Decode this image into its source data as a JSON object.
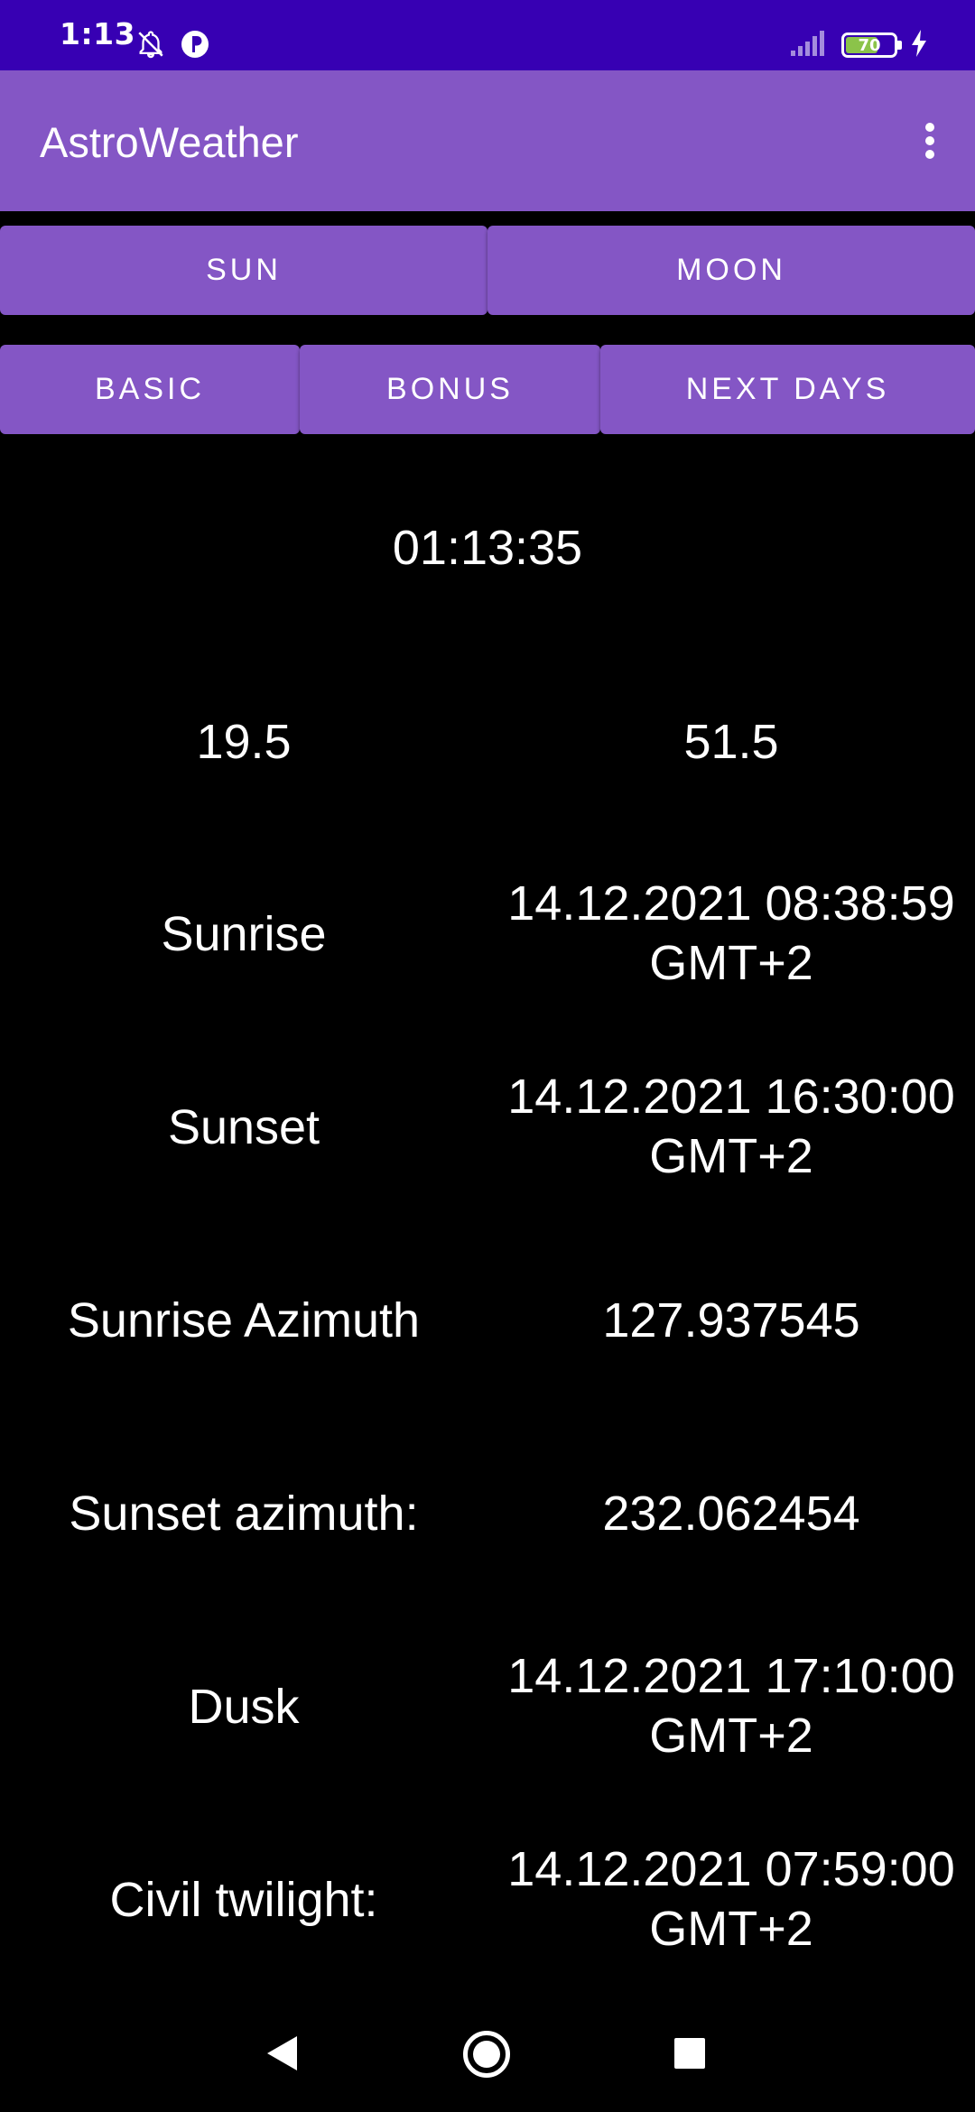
{
  "status_bar": {
    "time": "1:13",
    "battery_level": "70",
    "battery_fraction": 0.7,
    "icons": [
      "notifications-off-icon",
      "app-indicator-icon",
      "signal-icon",
      "battery-icon",
      "charging-bolt-icon"
    ]
  },
  "app_bar": {
    "title": "AstroWeather",
    "menu_icon": "more-vert-icon"
  },
  "tabs_row1": {
    "sun": "SUN",
    "moon": "MOON"
  },
  "tabs_row2": {
    "basic": "BASIC",
    "bonus": "BONUS",
    "next_days": "NEXT DAYS"
  },
  "clock": "01:13:35",
  "coordinates": {
    "longitude": "19.5",
    "latitude": "51.5"
  },
  "rows": [
    {
      "label": "Sunrise",
      "value_line1": "14.12.2021 08:38:59",
      "value_line2": "GMT+2"
    },
    {
      "label": "Sunset",
      "value_line1": "14.12.2021 16:30:00",
      "value_line2": "GMT+2"
    },
    {
      "label": "Sunrise Azimuth",
      "value_line1": "127.937545",
      "value_line2": ""
    },
    {
      "label": "Sunset azimuth:",
      "value_line1": "232.062454",
      "value_line2": ""
    },
    {
      "label": "Dusk",
      "value_line1": "14.12.2021 17:10:00",
      "value_line2": "GMT+2"
    },
    {
      "label": "Civil twilight:",
      "value_line1": "14.12.2021 07:59:00",
      "value_line2": "GMT+2"
    }
  ],
  "colors": {
    "status_bar": "#3700B3",
    "primary": "#8456C5",
    "background": "#000000",
    "text": "#FFFFFF",
    "battery_fill": "#8BC34A"
  },
  "nav_bar": {
    "icons": [
      "back-icon",
      "home-icon",
      "recents-icon"
    ]
  }
}
